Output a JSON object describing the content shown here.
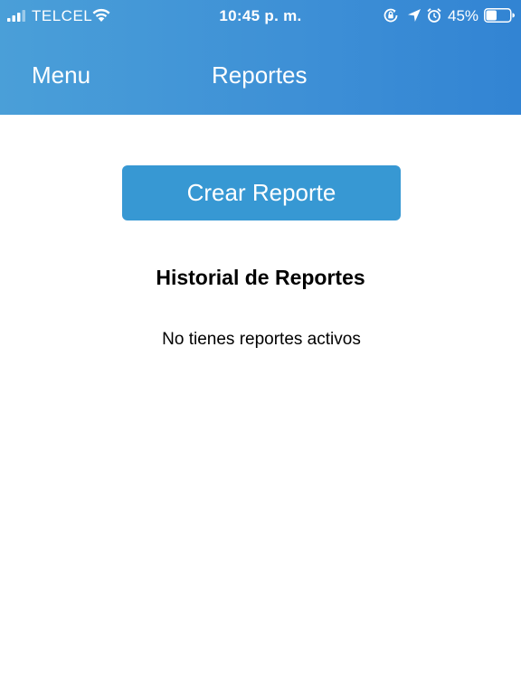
{
  "status_bar": {
    "carrier": "TELCEL",
    "time": "10:45 p. m.",
    "battery_percent": "45%",
    "battery_level": 0.45,
    "icons": [
      "signal-icon",
      "wifi-icon",
      "orientation-lock-icon",
      "location-icon",
      "alarm-icon",
      "battery-icon"
    ]
  },
  "nav": {
    "menu_label": "Menu",
    "title": "Reportes"
  },
  "main": {
    "create_button_label": "Crear Reporte",
    "history_title": "Historial de Reportes",
    "empty_message": "No tienes reportes activos"
  },
  "colors": {
    "header": "#3d8fd6",
    "button": "#3798d3",
    "background": "#ffffff"
  }
}
